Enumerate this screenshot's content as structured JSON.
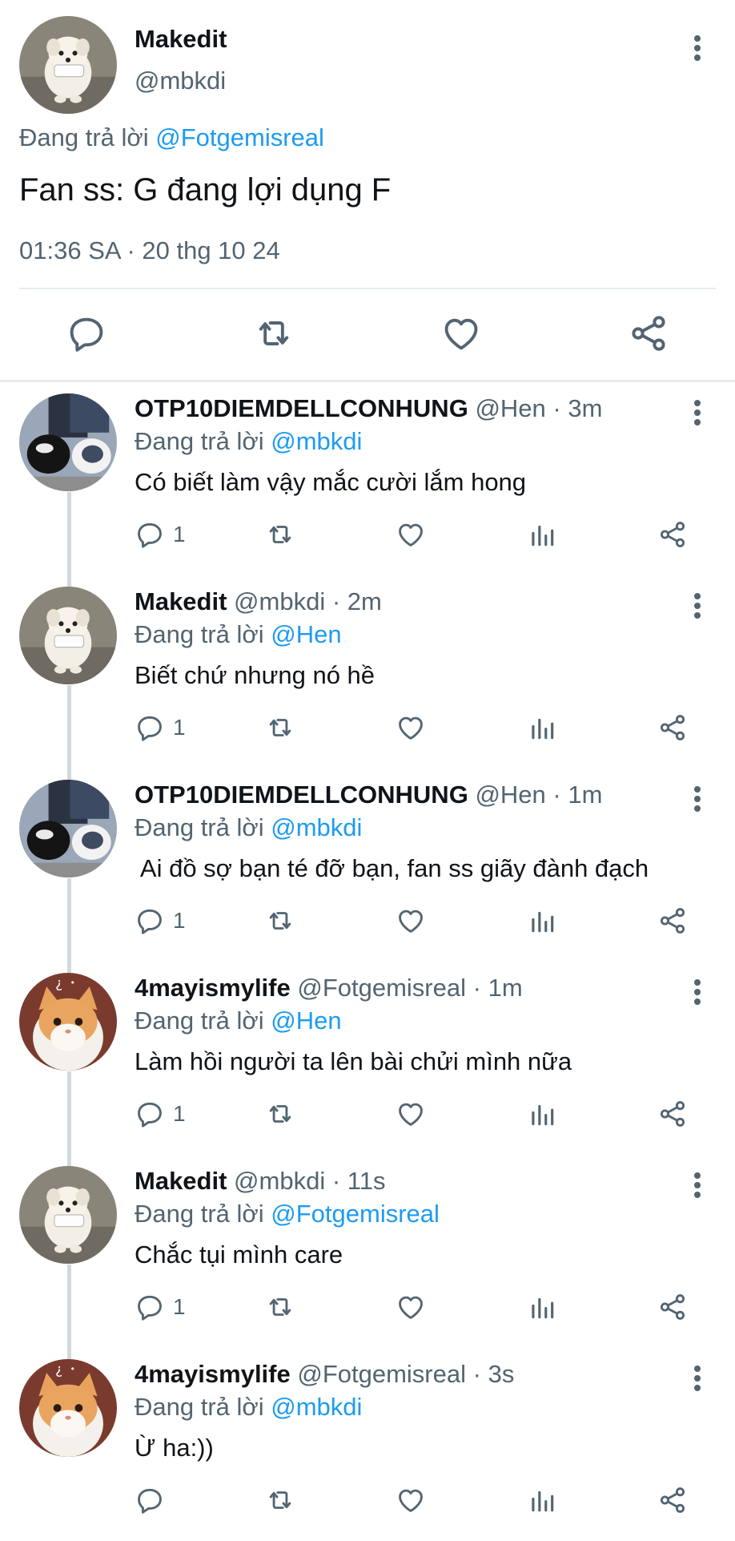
{
  "colors": {
    "accent": "#1d9bf0",
    "muted": "#536471",
    "text": "#0f1419",
    "divider": "#e6ecf0"
  },
  "main_tweet": {
    "author_name": "Makedit",
    "author_handle": "@mbkdi",
    "reply_prefix": "Đang trả lời",
    "reply_to": "@Fotgemisreal",
    "text": "Fan ss: G đang lợi dụng F",
    "timestamp": "01:36 SA · 20 thg 10 24",
    "avatar_icon": "dog-avatar-icon",
    "actions": [
      "reply-icon",
      "retweet-icon",
      "like-icon",
      "share-icon"
    ]
  },
  "replies": [
    {
      "name": "OTP10DIEMDELLCONHUNG",
      "handle": "@Hen",
      "time": "· 3m",
      "reply_prefix": "Đang trả lời",
      "reply_to": "@mbkdi",
      "text": "Có biết làm vậy mắc cười lắm hong",
      "reply_count": "1",
      "avatar": "shoes-avatar-icon"
    },
    {
      "name": "Makedit",
      "handle": "@mbkdi",
      "time": "· 2m",
      "reply_prefix": "Đang trả lời",
      "reply_to": "@Hen",
      "text": "Biết chứ nhưng nó hề",
      "reply_count": "1",
      "avatar": "dog-avatar-icon"
    },
    {
      "name": "OTP10DIEMDELLCONHUNG",
      "handle": "@Hen",
      "time": "· 1m",
      "reply_prefix": "Đang trả lời",
      "reply_to": "@mbkdi",
      "text": " Ai đồ sợ bạn té đỡ bạn, fan ss giãy đành đạch",
      "reply_count": "1",
      "avatar": "shoes-avatar-icon"
    },
    {
      "name": "4mayismylife",
      "handle": "@Fotgemisreal",
      "time": "· 1m",
      "reply_prefix": "Đang trả lời",
      "reply_to": "@Hen",
      "text": "Làm hồi người ta lên bài chửi mình nữa",
      "reply_count": "1",
      "avatar": "cat-avatar-icon"
    },
    {
      "name": "Makedit",
      "handle": "@mbkdi",
      "time": "· 11s",
      "reply_prefix": "Đang trả lời",
      "reply_to": "@Fotgemisreal",
      "text": "Chắc tụi mình care",
      "reply_count": "1",
      "avatar": "dog-avatar-icon"
    },
    {
      "name": "4mayismylife",
      "handle": "@Fotgemisreal",
      "time": "· 3s",
      "reply_prefix": "Đang trả lời",
      "reply_to": "@mbkdi",
      "text": "Ừ ha:))",
      "reply_count": "",
      "avatar": "cat-avatar-icon"
    }
  ]
}
